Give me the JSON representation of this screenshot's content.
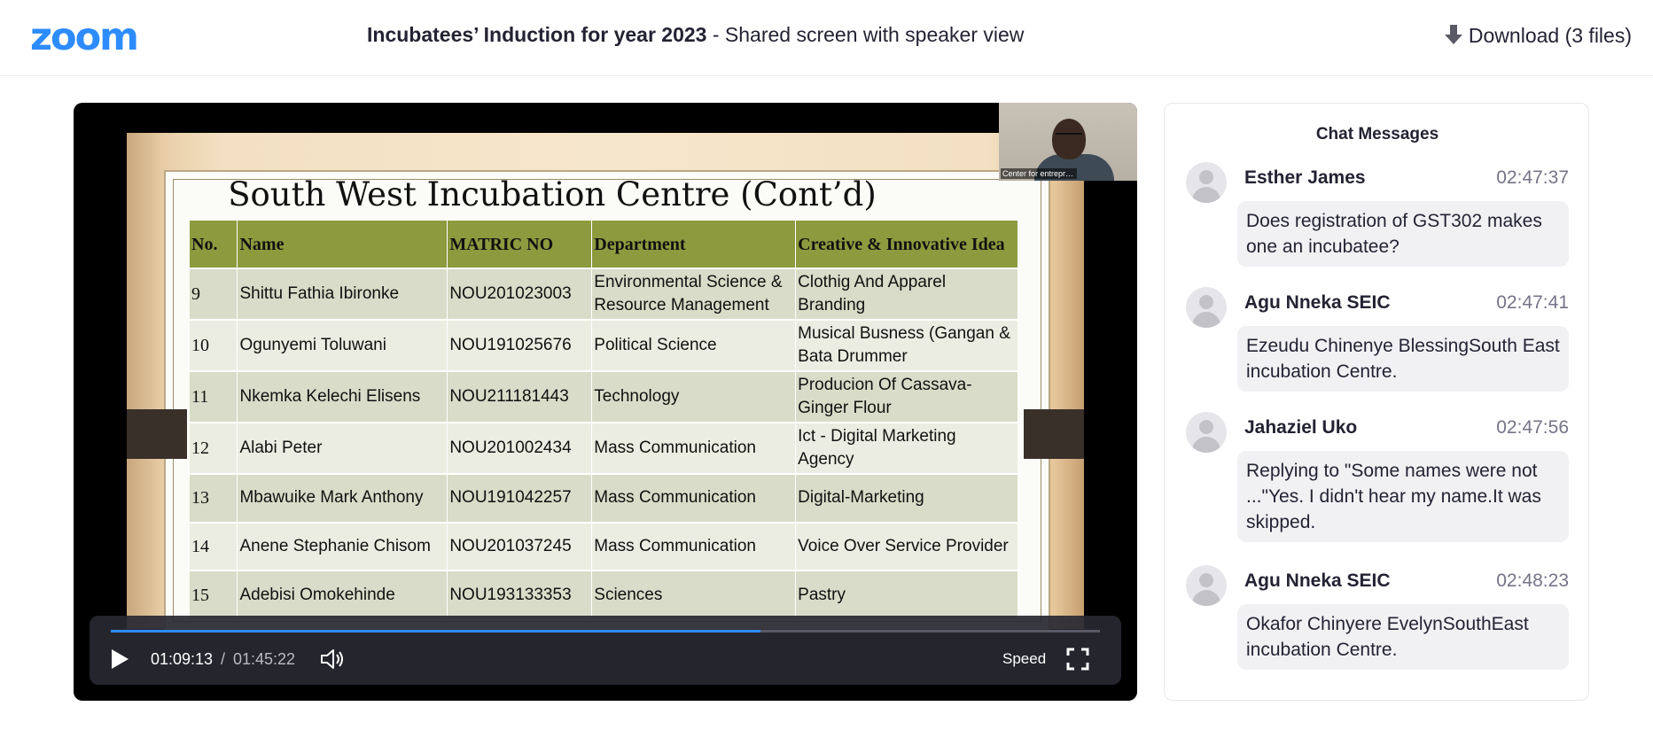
{
  "header": {
    "logo": "zoom",
    "title_bold": "Incubatees’ Induction for year 2023",
    "title_rest": " - Shared screen with speaker view",
    "download_label": "Download (3 files)"
  },
  "slide": {
    "title": "South West Incubation Centre (Cont’d)",
    "columns": [
      "No.",
      "Name",
      "MATRIC NO",
      "Department",
      "Creative & Innovative Idea"
    ],
    "rows": [
      [
        "9",
        "Shittu Fathia Ibironke",
        "NOU201023003",
        "Environmental Science & Resource Management",
        "Clothig And Apparel Branding"
      ],
      [
        "10",
        "Ogunyemi Toluwani",
        "NOU191025676",
        "Political Science",
        "Musical Busness (Gangan & Bata Drummer"
      ],
      [
        "11",
        "Nkemka Kelechi Elisens",
        "NOU211181443",
        "Technology",
        "Producion Of Cassava-Ginger Flour"
      ],
      [
        "12",
        "Alabi Peter",
        "NOU201002434",
        "Mass Communication",
        "Ict - Digital Marketing Agency"
      ],
      [
        "13",
        "Mbawuike Mark Anthony",
        "NOU191042257",
        "Mass Communication",
        "Digital-Marketing"
      ],
      [
        "14",
        "Anene Stephanie Chisom",
        "NOU201037245",
        "Mass Communication",
        "Voice Over Service Provider"
      ],
      [
        "15",
        "Adebisi Omokehinde",
        "NOU193133353",
        "Sciences",
        "Pastry"
      ]
    ]
  },
  "speaker": {
    "label": "Center for entrepren..."
  },
  "player": {
    "current_time": "01:09:13",
    "separator": "/",
    "duration": "01:45:22",
    "progress_fraction": 0.657,
    "speed_label": "Speed",
    "accent_color": "#2d8cff"
  },
  "chat": {
    "title": "Chat Messages",
    "messages": [
      {
        "sender": "Esther James",
        "time": "02:47:37",
        "text": "Does registration of GST302 makes one an incubatee?"
      },
      {
        "sender": "Agu Nneka SEIC",
        "time": "02:47:41",
        "text": "Ezeudu Chinenye BlessingSouth East incubation Centre."
      },
      {
        "sender": "Jahaziel Uko",
        "time": "02:47:56",
        "text": "Replying to \"Some names were not ...\"Yes. I didn't hear my name.It was skipped."
      },
      {
        "sender": "Agu Nneka SEIC",
        "time": "02:48:23",
        "text": "Okafor Chinyere EvelynSouthEast incubation Centre."
      }
    ]
  }
}
